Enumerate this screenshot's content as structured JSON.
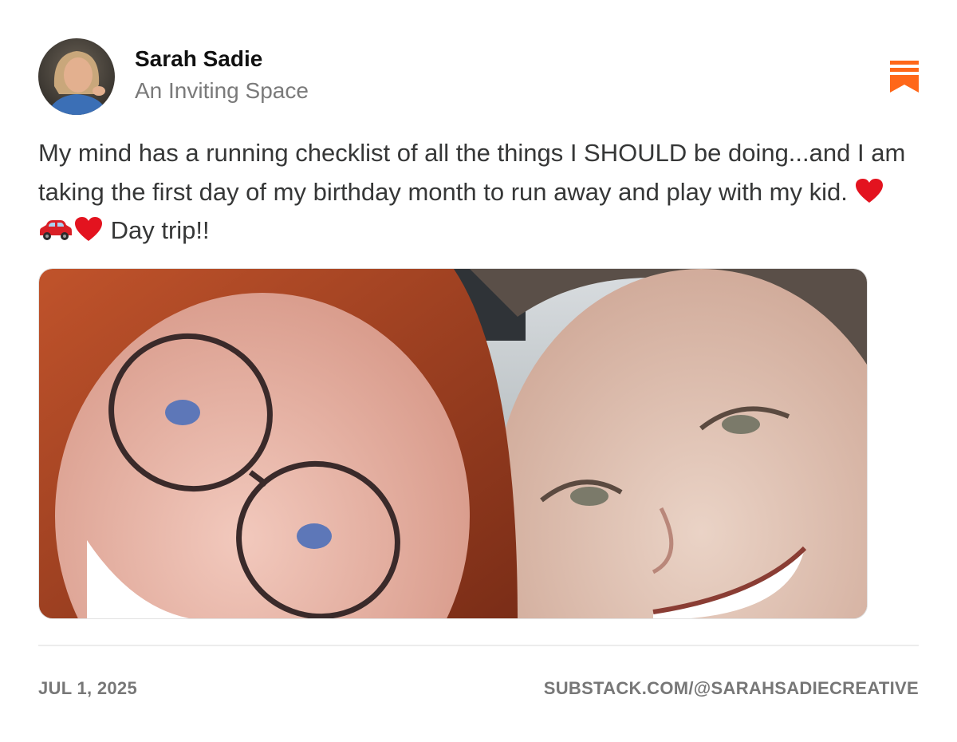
{
  "author": {
    "name": "Sarah Sadie",
    "publication": "An Inviting Space",
    "avatar_icon": "author-avatar"
  },
  "post": {
    "text_before_emoji": "My mind has a running checklist of all the things I SHOULD be doing...and I am taking the first day of my birthday month to run away and play with my kid. ",
    "emojis": [
      "red-heart",
      "red-car",
      "red-heart"
    ],
    "text_after_emoji": " Day trip!!",
    "photo_alt_icon": "selfie-photo"
  },
  "footer": {
    "date": "JUL 1, 2025",
    "url": "SUBSTACK.COM/@SARAHSADIECREATIVE"
  },
  "colors": {
    "brand_accent": "#ff6719",
    "text_primary": "#363737",
    "text_muted": "#777777"
  },
  "icons": {
    "bookmark": "substack-bookmark-icon"
  }
}
